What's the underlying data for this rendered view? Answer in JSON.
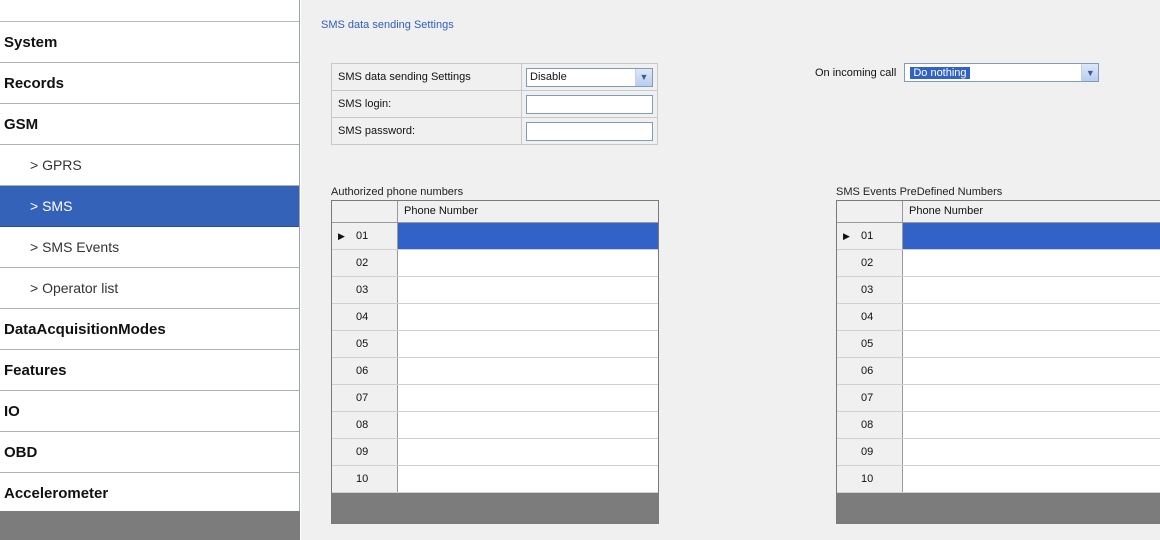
{
  "sidebar": {
    "items": [
      {
        "label": "System"
      },
      {
        "label": "Records"
      },
      {
        "label": "GSM"
      },
      {
        "label": "> GPRS"
      },
      {
        "label": "> SMS"
      },
      {
        "label": "> SMS Events"
      },
      {
        "label": "> Operator list"
      },
      {
        "label": "DataAcquisitionModes"
      },
      {
        "label": "Features"
      },
      {
        "label": "IO"
      },
      {
        "label": "OBD"
      },
      {
        "label": "Accelerometer"
      }
    ],
    "selected": "> SMS"
  },
  "group_title": "SMS data sending Settings",
  "settings": {
    "data_sending_label": "SMS data sending Settings",
    "data_sending_value": "Disable",
    "login_label": "SMS login:",
    "login_value": "",
    "password_label": "SMS password:",
    "password_value": ""
  },
  "incoming_call": {
    "label": "On incoming call",
    "value": "Do nothing"
  },
  "authorized_grid": {
    "title": "Authorized phone numbers",
    "column": "Phone Number",
    "rows": [
      "01",
      "02",
      "03",
      "04",
      "05",
      "06",
      "07",
      "08",
      "09",
      "10"
    ],
    "marker": "▶"
  },
  "predefined_grid": {
    "title": "SMS Events PreDefined Numbers",
    "column": "Phone Number",
    "rows": [
      "01",
      "02",
      "03",
      "04",
      "05",
      "06",
      "07",
      "08",
      "09",
      "10"
    ],
    "marker": "▶"
  },
  "icons": {
    "dropdown": "chevron-down-icon",
    "row_pointer": "row-pointer-icon"
  },
  "colors": {
    "selection": "#3162c8",
    "sidebar_selected": "#3462b9",
    "group_title": "#2e5fbf"
  }
}
